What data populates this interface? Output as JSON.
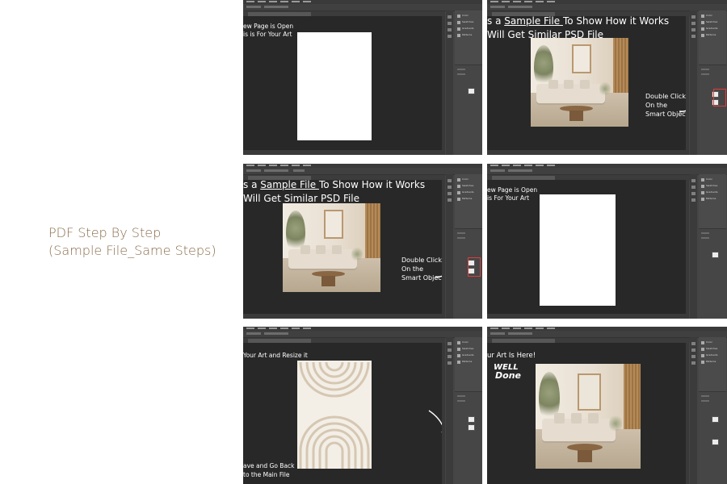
{
  "page": {
    "title_line1": "PDF Step By Step",
    "title_line2": "(Sample File_Same Steps)"
  },
  "steps": {
    "s1": {
      "caption1": "ew Page is Open",
      "caption2": "is is For Your Art"
    },
    "s2": {
      "line1_pre": "s a ",
      "line1_link": "Sample File ",
      "line1_post": "To Show How it Works",
      "line2": "Will Get Similar PSD File",
      "hint1": "Double Click",
      "hint2": "On the",
      "hint3": "Smart Object"
    },
    "s3": {
      "line1_pre": "s a ",
      "line1_link": "Sample File ",
      "line1_post": "To Show How it Works",
      "line2": "Will Get Similar PSD File",
      "hint1": "Double Click",
      "hint2": "On the",
      "hint3": "Smart Object"
    },
    "s4": {
      "caption1": "ew Page is Open",
      "caption2": "is For Your Art"
    },
    "s5": {
      "caption_top": "Your Art and Resize it",
      "caption_b1": "ave and Go Back",
      "caption_b2": "to the Main File"
    },
    "s6": {
      "caption_top": "ur Art Is Here!",
      "badge1": "WELL",
      "badge2": "Done"
    }
  },
  "panel_labels": [
    "Color",
    "Swatches",
    "Gradients",
    "Patterns"
  ],
  "colors": {
    "accent_text": "#8a6c4a",
    "canvas": "#282828",
    "ui": "#454545",
    "highlight": "#e23b3b"
  }
}
